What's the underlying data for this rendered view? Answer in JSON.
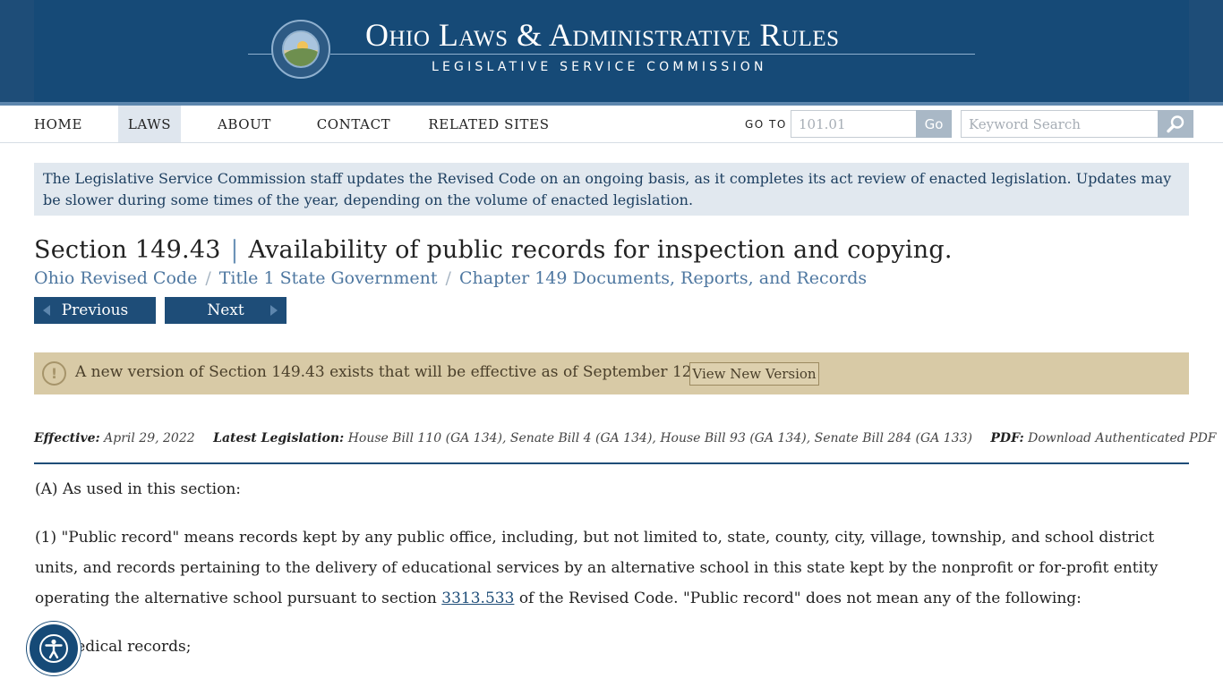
{
  "header": {
    "site_title": "Ohio Laws & Administrative Rules",
    "site_subtitle": "LEGISLATIVE SERVICE COMMISSION"
  },
  "nav": {
    "items": [
      {
        "label": "HOME"
      },
      {
        "label": "LAWS"
      },
      {
        "label": "ABOUT"
      },
      {
        "label": "CONTACT"
      },
      {
        "label": "RELATED SITES"
      }
    ],
    "active": "LAWS",
    "goto_label": "GO TO",
    "goto_placeholder": "101.01",
    "goto_button": "Go",
    "search_placeholder": "Keyword Search"
  },
  "notice": "The Legislative Service Commission staff updates the Revised Code on an ongoing basis, as it completes its act review of enacted legislation. Updates may be slower during some times of the year, depending on the volume of enacted legislation.",
  "section": {
    "number": "Section 149.43",
    "separator": "|",
    "title": "Availability of public records for inspection and copying.",
    "breadcrumb": [
      "Ohio Revised Code",
      "Title 1 State Government",
      "Chapter 149 Documents, Reports, and Records"
    ],
    "previous_label": "Previous",
    "next_label": "Next"
  },
  "version_banner": {
    "text": "A new version of Section 149.43 exists that will be effective as of September 12, 2022",
    "button": "View New Version",
    "icon": "exclamation-circle-icon"
  },
  "meta": {
    "effective_label": "Effective:",
    "effective_value": "April 29, 2022",
    "legislation_label": "Latest Legislation:",
    "legislation_value": "House Bill 110 (GA 134), Senate Bill 4 (GA 134), House Bill 93 (GA 134), Senate Bill 284 (GA 133)",
    "pdf_label": "PDF:",
    "pdf_value": "Download Authenticated PDF"
  },
  "body": {
    "p1": "(A) As used in this section:",
    "p2_before": "(1) \"Public record\" means records kept by any public office, including, but not limited to, state, county, city, village, township, and school district units, and records pertaining to the delivery of educational services by an alternative school in this state kept by the nonprofit or for-profit entity operating the alternative school pursuant to section ",
    "p2_link": "3313.533",
    "p2_after": " of the Revised Code. \"Public record\" does not mean any of the following:",
    "p3": "(a) Medical records;"
  },
  "accessibility_icon": "accessibility-icon",
  "colors": {
    "header_blue": "#164a77",
    "nav_active": "#dfe6ee",
    "banner_tan": "#d8caa6",
    "link_blue": "#4e77a0"
  }
}
